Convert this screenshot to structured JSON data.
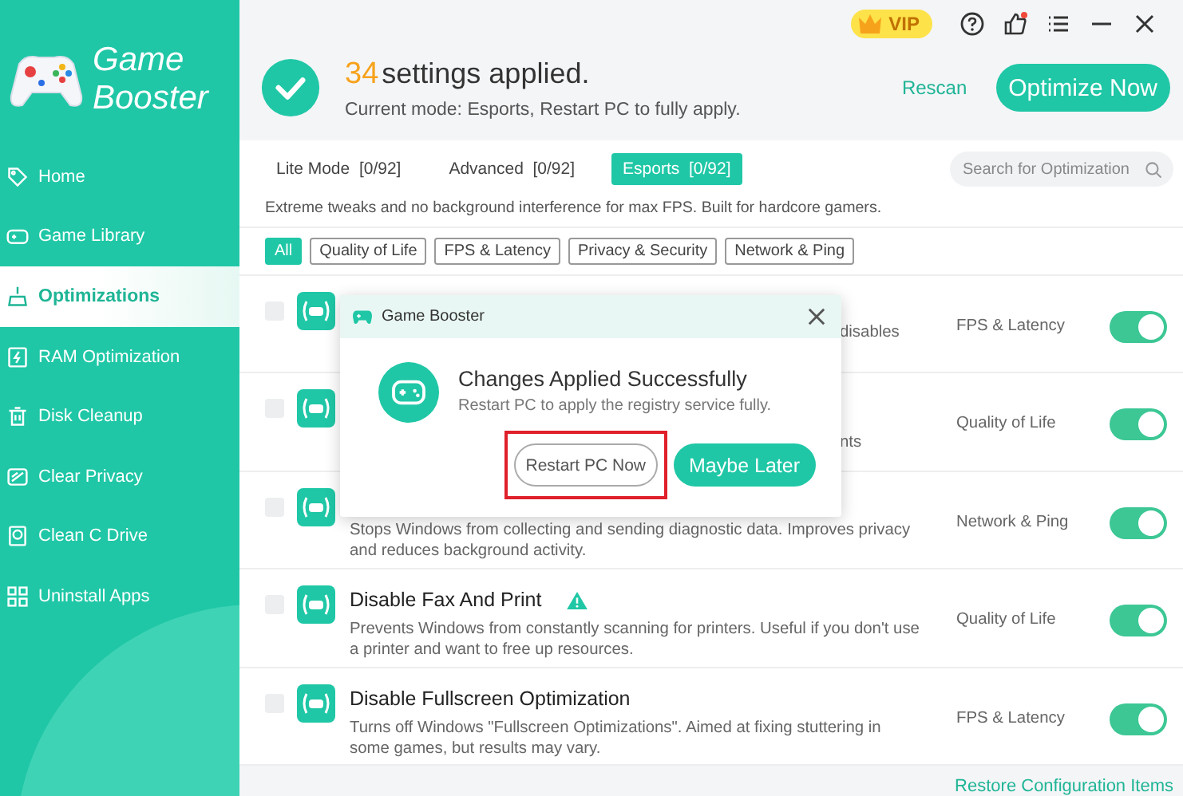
{
  "app": {
    "title_line1": "Game",
    "title_line2": "Booster"
  },
  "sidebar": {
    "items": [
      {
        "label": "Home",
        "selected": false
      },
      {
        "label": "Game Library",
        "selected": false
      },
      {
        "label": "Optimizations",
        "selected": true
      },
      {
        "label": "RAM Optimization",
        "selected": false
      },
      {
        "label": "Disk Cleanup",
        "selected": false
      },
      {
        "label": "Clear Privacy",
        "selected": false
      },
      {
        "label": "Clean C Drive",
        "selected": false
      },
      {
        "label": "Uninstall Apps",
        "selected": false
      }
    ]
  },
  "topbar": {
    "vip": "VIP",
    "notification_dot": true
  },
  "summary": {
    "count": "34",
    "headline": "settings applied.",
    "subtitle": "Current mode: Esports, Restart PC to fully apply.",
    "rescan": "Rescan",
    "optimize_button": "Optimize Now"
  },
  "mode_tabs": [
    {
      "label": "Lite Mode  [0/92]",
      "selected": false
    },
    {
      "label": "Advanced  [0/92]",
      "selected": false
    },
    {
      "label": "Esports  [0/92]",
      "selected": true
    }
  ],
  "search": {
    "placeholder": "Search for Optimization"
  },
  "mode_description": "Extreme tweaks and no background interference for max FPS. Built for hardcore gamers.",
  "filters": [
    {
      "label": "All",
      "selected": true
    },
    {
      "label": "Quality of Life",
      "selected": false
    },
    {
      "label": "FPS & Latency",
      "selected": false
    },
    {
      "label": "Privacy & Security",
      "selected": false
    },
    {
      "label": "Network & Ping",
      "selected": false
    }
  ],
  "settings": [
    {
      "fragment": "disables",
      "category": "FPS & Latency",
      "checked": false,
      "on": true
    },
    {
      "fragment": "nts",
      "category": "Quality of Life",
      "checked": false,
      "on": true
    },
    {
      "description": "Stops Windows from collecting and sending diagnostic data. Improves privacy and reduces background activity.",
      "category": "Network & Ping",
      "checked": false,
      "on": true
    },
    {
      "title": "Disable Fax And Print",
      "warning": true,
      "description": "Prevents Windows from constantly scanning for printers. Useful if you don't use a printer and want to free up resources.",
      "category": "Quality of Life",
      "checked": false,
      "on": true
    },
    {
      "title": "Disable Fullscreen Optimization",
      "warning": false,
      "description": "Turns off Windows \"Fullscreen Optimizations\". Aimed at fixing stuttering in some games, but results may vary.",
      "category": "FPS & Latency",
      "checked": false,
      "on": true
    }
  ],
  "footer_link": "Restore Configuration Items",
  "dialog": {
    "title": "Game Booster",
    "heading": "Changes Applied Successfully",
    "message": "Restart PC to apply the registry service fully.",
    "buttons": [
      {
        "label": "Restart PC Now",
        "kind": "secondary",
        "highlighted": true
      },
      {
        "label": "Maybe Later",
        "kind": "primary",
        "highlighted": false
      }
    ]
  }
}
